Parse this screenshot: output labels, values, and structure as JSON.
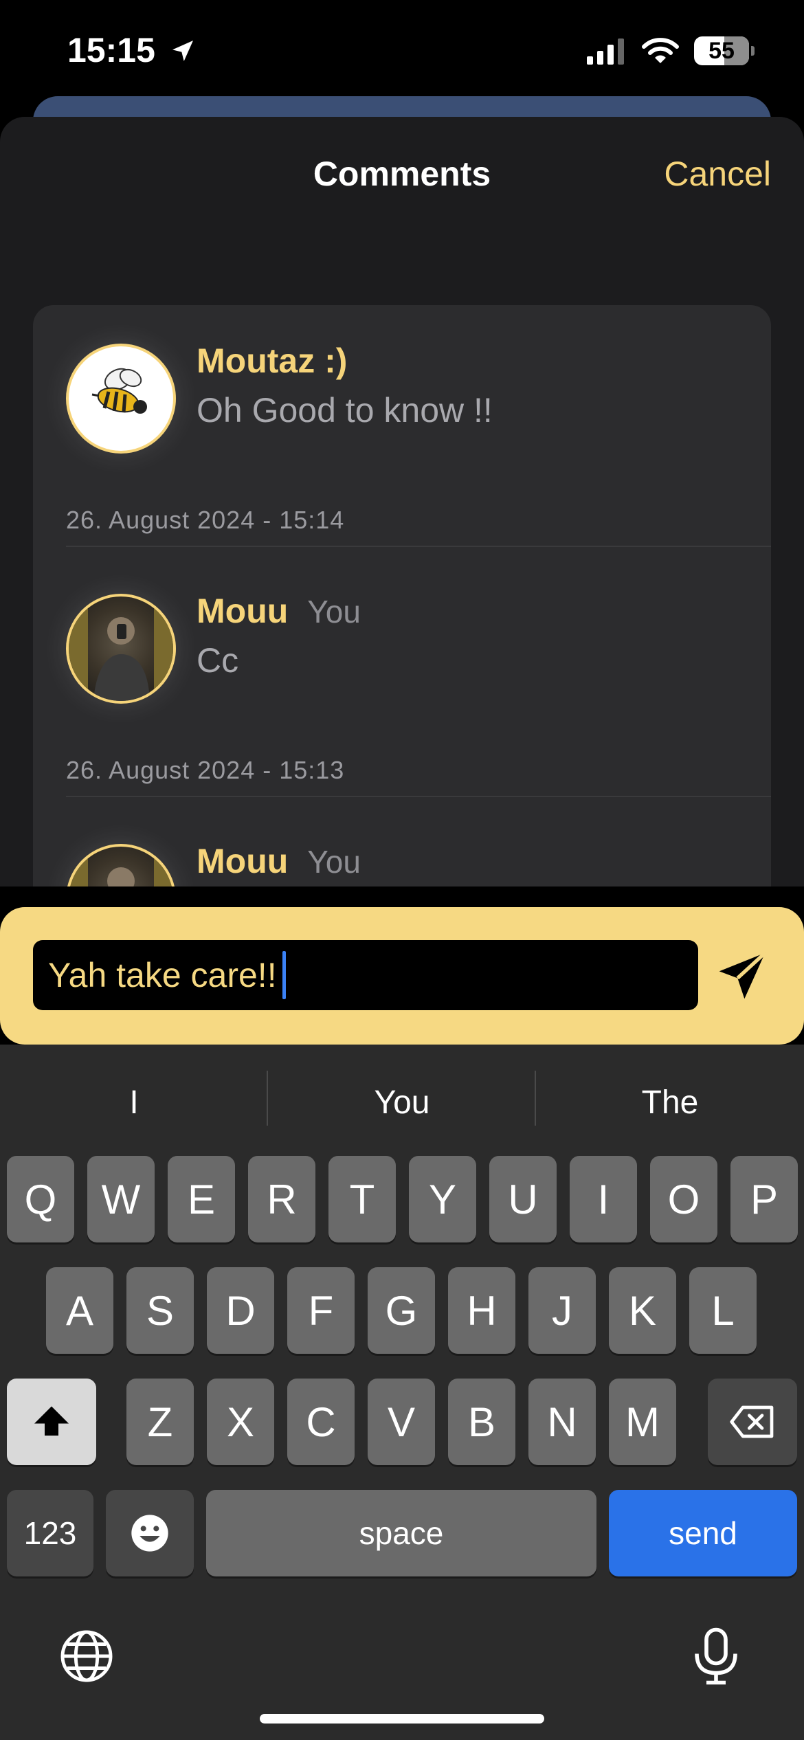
{
  "status": {
    "time": "15:15",
    "battery": "55"
  },
  "sheet": {
    "title": "Comments",
    "cancel_label": "Cancel"
  },
  "comments": [
    {
      "name": "Moutaz :)",
      "you_tag": "",
      "text": "Oh Good to know !!",
      "date": "26. August 2024 - 15:14",
      "avatar": "bee-avatar"
    },
    {
      "name": "Mouu",
      "you_tag": "You",
      "text": "Cc",
      "date": "26. August 2024 - 15:13",
      "avatar": "photo-avatar"
    },
    {
      "name": "Mouu",
      "you_tag": "You",
      "text": "",
      "date": "",
      "avatar": "photo-avatar"
    }
  ],
  "composer": {
    "value": "Yah take care!!"
  },
  "keyboard": {
    "suggestions": [
      "I",
      "You",
      "The"
    ],
    "row1": [
      "Q",
      "W",
      "E",
      "R",
      "T",
      "Y",
      "U",
      "I",
      "O",
      "P"
    ],
    "row2": [
      "A",
      "S",
      "D",
      "F",
      "G",
      "H",
      "J",
      "K",
      "L"
    ],
    "row3": [
      "Z",
      "X",
      "C",
      "V",
      "B",
      "N",
      "M"
    ],
    "numbers_label": "123",
    "space_label": "space",
    "send_label": "send"
  },
  "colors": {
    "accent": "#f6d47a",
    "composer_bg": "#f6d983",
    "send_key": "#2a72e8"
  }
}
